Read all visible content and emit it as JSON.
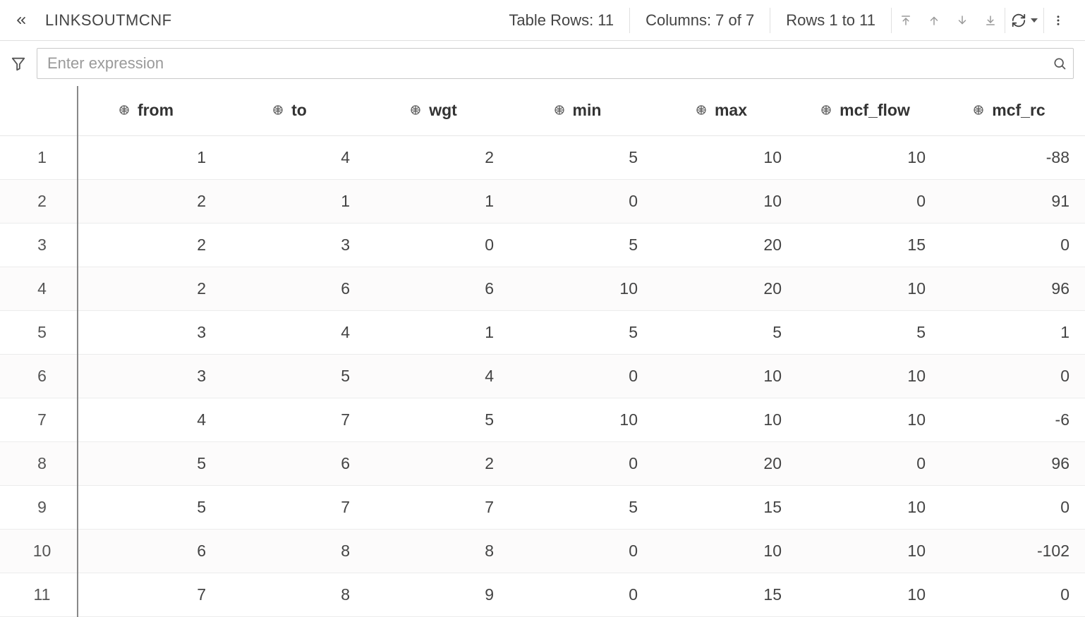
{
  "header": {
    "title": "LINKSOUTMCNF",
    "table_rows_label": "Table Rows: 11",
    "columns_label": "Columns: 7 of 7",
    "rows_range_label": "Rows 1 to 11"
  },
  "filter": {
    "placeholder": "Enter expression"
  },
  "table": {
    "columns": [
      "from",
      "to",
      "wgt",
      "min",
      "max",
      "mcf_flow",
      "mcf_rc"
    ],
    "rows": [
      {
        "n": "1",
        "from": "1",
        "to": "4",
        "wgt": "2",
        "min": "5",
        "max": "10",
        "mcf_flow": "10",
        "mcf_rc": "-88"
      },
      {
        "n": "2",
        "from": "2",
        "to": "1",
        "wgt": "1",
        "min": "0",
        "max": "10",
        "mcf_flow": "0",
        "mcf_rc": "91"
      },
      {
        "n": "3",
        "from": "2",
        "to": "3",
        "wgt": "0",
        "min": "5",
        "max": "20",
        "mcf_flow": "15",
        "mcf_rc": "0"
      },
      {
        "n": "4",
        "from": "2",
        "to": "6",
        "wgt": "6",
        "min": "10",
        "max": "20",
        "mcf_flow": "10",
        "mcf_rc": "96"
      },
      {
        "n": "5",
        "from": "3",
        "to": "4",
        "wgt": "1",
        "min": "5",
        "max": "5",
        "mcf_flow": "5",
        "mcf_rc": "1"
      },
      {
        "n": "6",
        "from": "3",
        "to": "5",
        "wgt": "4",
        "min": "0",
        "max": "10",
        "mcf_flow": "10",
        "mcf_rc": "0"
      },
      {
        "n": "7",
        "from": "4",
        "to": "7",
        "wgt": "5",
        "min": "10",
        "max": "10",
        "mcf_flow": "10",
        "mcf_rc": "-6"
      },
      {
        "n": "8",
        "from": "5",
        "to": "6",
        "wgt": "2",
        "min": "0",
        "max": "20",
        "mcf_flow": "0",
        "mcf_rc": "96"
      },
      {
        "n": "9",
        "from": "5",
        "to": "7",
        "wgt": "7",
        "min": "5",
        "max": "15",
        "mcf_flow": "10",
        "mcf_rc": "0"
      },
      {
        "n": "10",
        "from": "6",
        "to": "8",
        "wgt": "8",
        "min": "0",
        "max": "10",
        "mcf_flow": "10",
        "mcf_rc": "-102"
      },
      {
        "n": "11",
        "from": "7",
        "to": "8",
        "wgt": "9",
        "min": "0",
        "max": "15",
        "mcf_flow": "10",
        "mcf_rc": "0"
      }
    ]
  }
}
